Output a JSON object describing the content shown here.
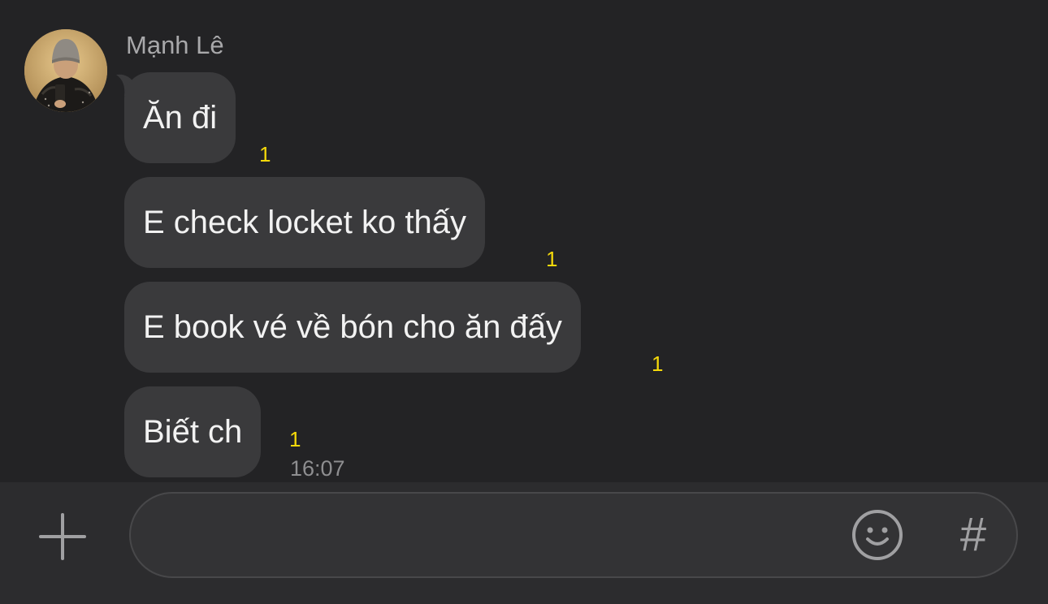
{
  "conversation": {
    "sender_name": "Mạnh Lê",
    "messages": [
      {
        "text": "Ăn đi",
        "unread_count": "1"
      },
      {
        "text": "E check locket ko thấy",
        "unread_count": "1"
      },
      {
        "text": "E book vé về bón cho ăn đấy",
        "unread_count": "1"
      },
      {
        "text": "Biết ch",
        "unread_count": "1"
      }
    ],
    "last_timestamp": "16:07"
  },
  "composer": {
    "message_value": "",
    "plus_icon": "plus-icon",
    "emoji_icon": "smiley-icon",
    "hashtag_label": "#"
  },
  "colors": {
    "background": "#232325",
    "bubble": "#3a3a3c",
    "unread_badge": "#f5d90a",
    "input_bar": "#2c2c2e"
  }
}
